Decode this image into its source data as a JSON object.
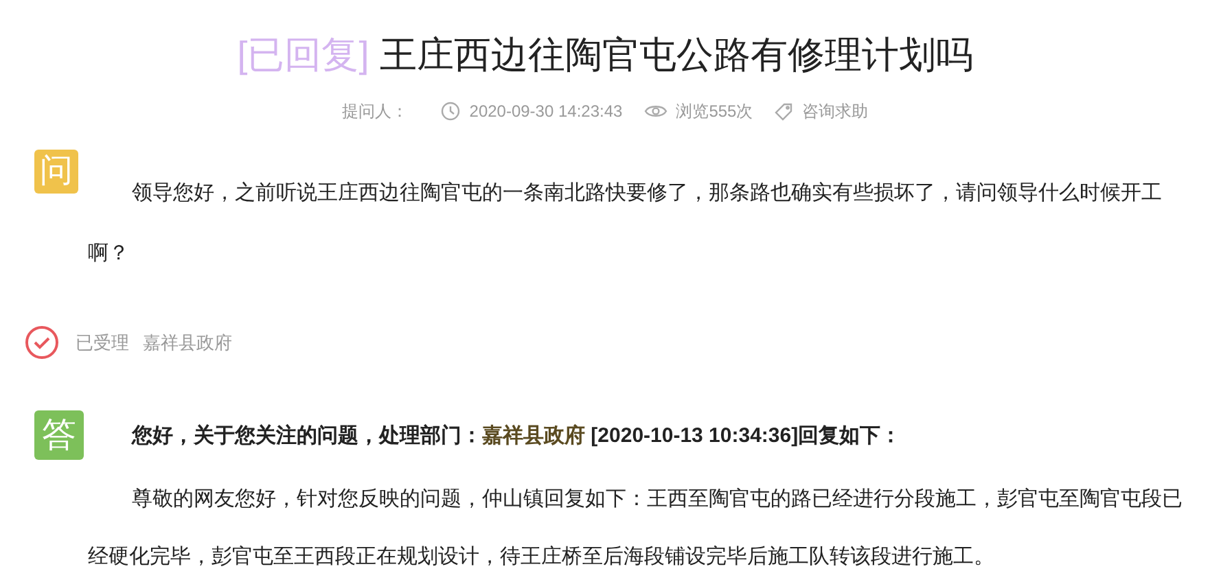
{
  "title": {
    "status": "[已回复]",
    "text": "王庄西边往陶官屯公路有修理计划吗"
  },
  "meta": {
    "asker_label": "提问人：",
    "time": "2020-09-30 14:23:43",
    "views": "浏览555次",
    "category": "咨询求助"
  },
  "question": {
    "badge": "问",
    "text": "领导您好，之前听说王庄西边往陶官屯的一条南北路快要修了，那条路也确实有些损坏了，请问领导什么时候开工啊？"
  },
  "status": {
    "accepted": true,
    "label": "已受理",
    "department": "嘉祥县政府"
  },
  "answer": {
    "badge": "答",
    "heading": {
      "before": "您好，关于您关注的问题，处理部门：",
      "department": "嘉祥县政府",
      "after": " [2020-10-13 10:34:36]回复如下："
    },
    "text": "尊敬的网友您好，针对您反映的问题，仲山镇回复如下：王西至陶官屯的路已经进行分段施工，彭官屯至陶官屯段已经硬化完毕，彭官屯至王西段正在规划设计，待王庄桥至后海段铺设完毕后施工队转该段进行施工。"
  }
}
